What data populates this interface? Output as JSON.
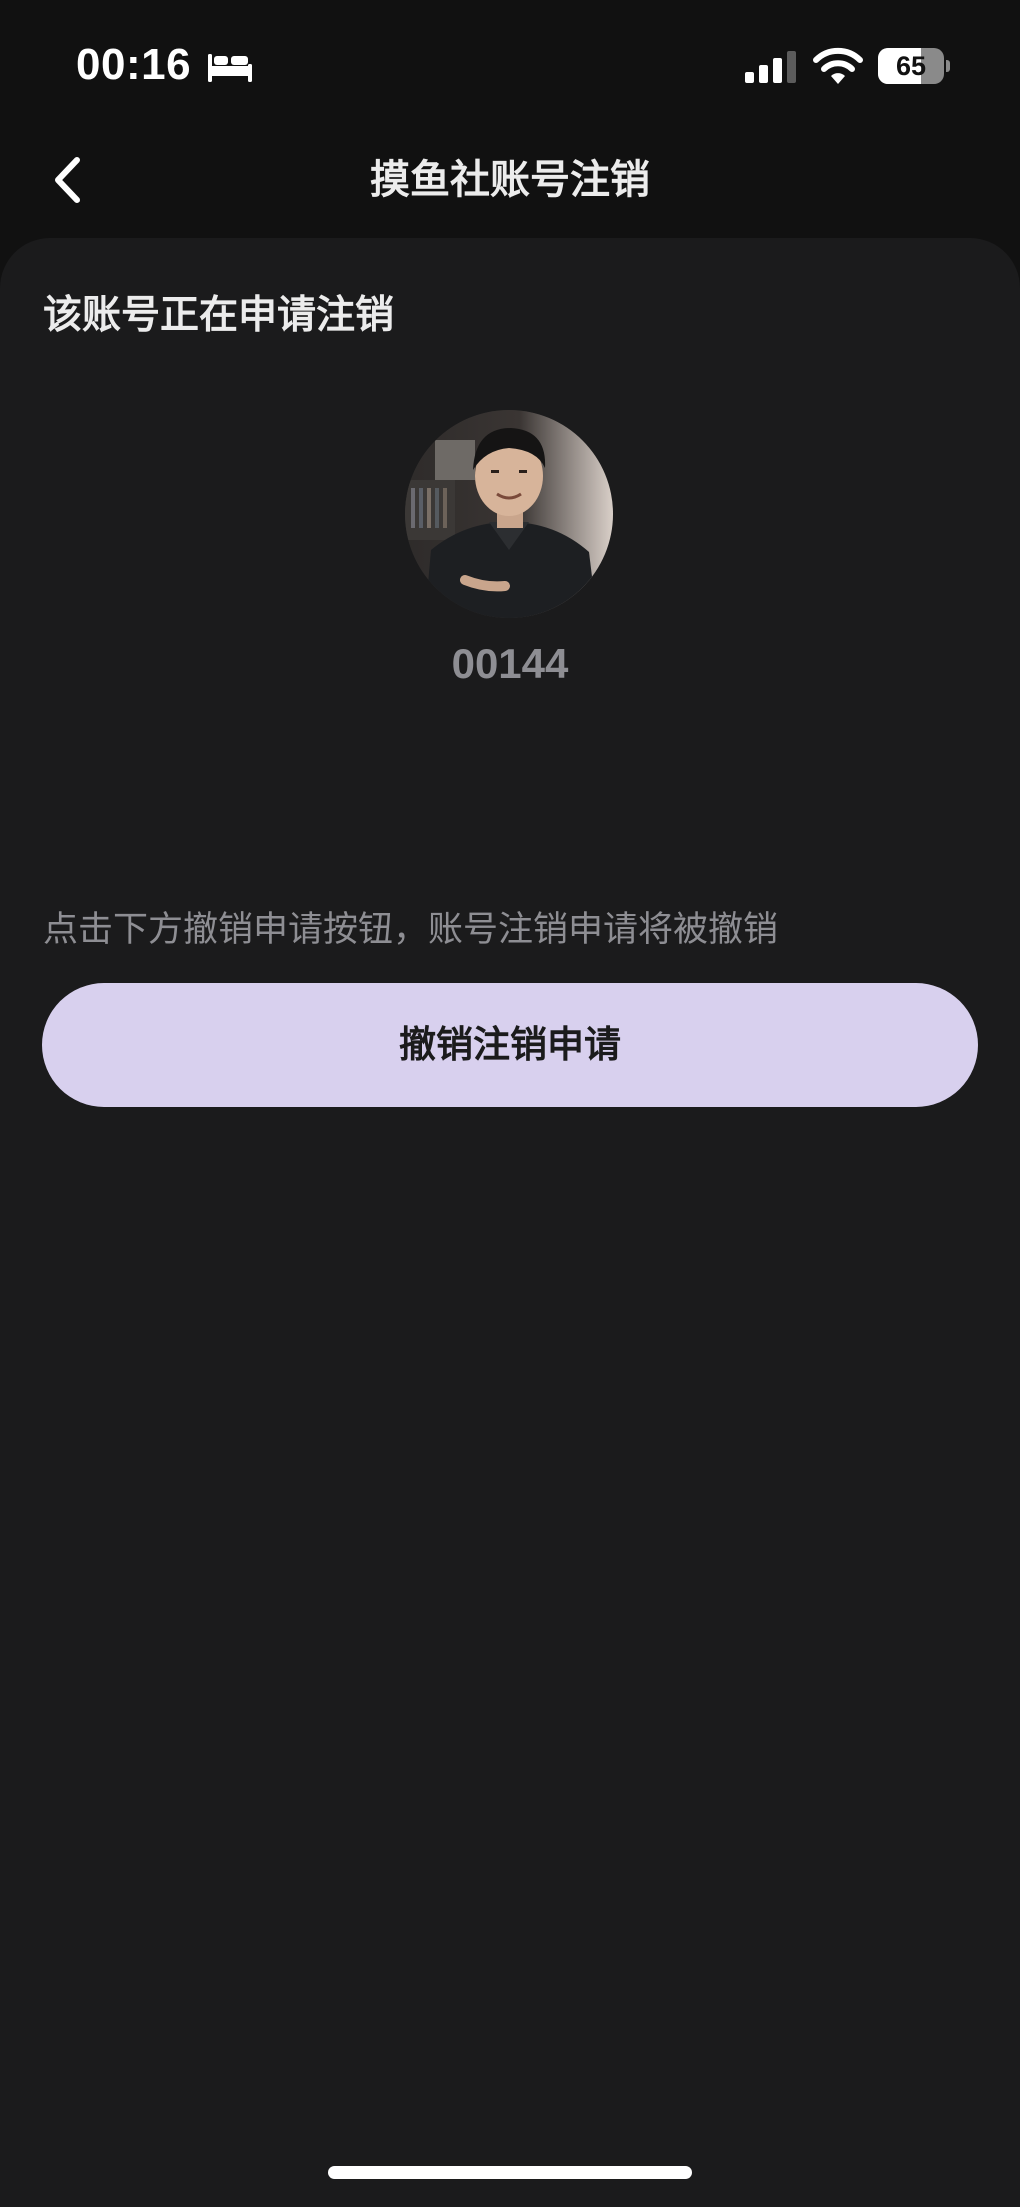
{
  "status_bar": {
    "time": "00:16",
    "sleep_icon": "bed-icon",
    "signal_icon": "cellular-signal-icon",
    "wifi_icon": "wifi-icon",
    "battery_level": "65",
    "battery_fraction": 0.65
  },
  "nav": {
    "back_icon": "chevron-left-icon",
    "title": "摸鱼社账号注销"
  },
  "account": {
    "section_title": "该账号正在申请注销",
    "user_id": "00144"
  },
  "hint": "点击下方撤销申请按钮，账号注销申请将被撤销",
  "revoke_button": "撤销注销申请",
  "colors": {
    "background": "#111111",
    "card": "#1b1b1c",
    "button": "#d8d0ee",
    "muted_text": "#8e8e93"
  }
}
